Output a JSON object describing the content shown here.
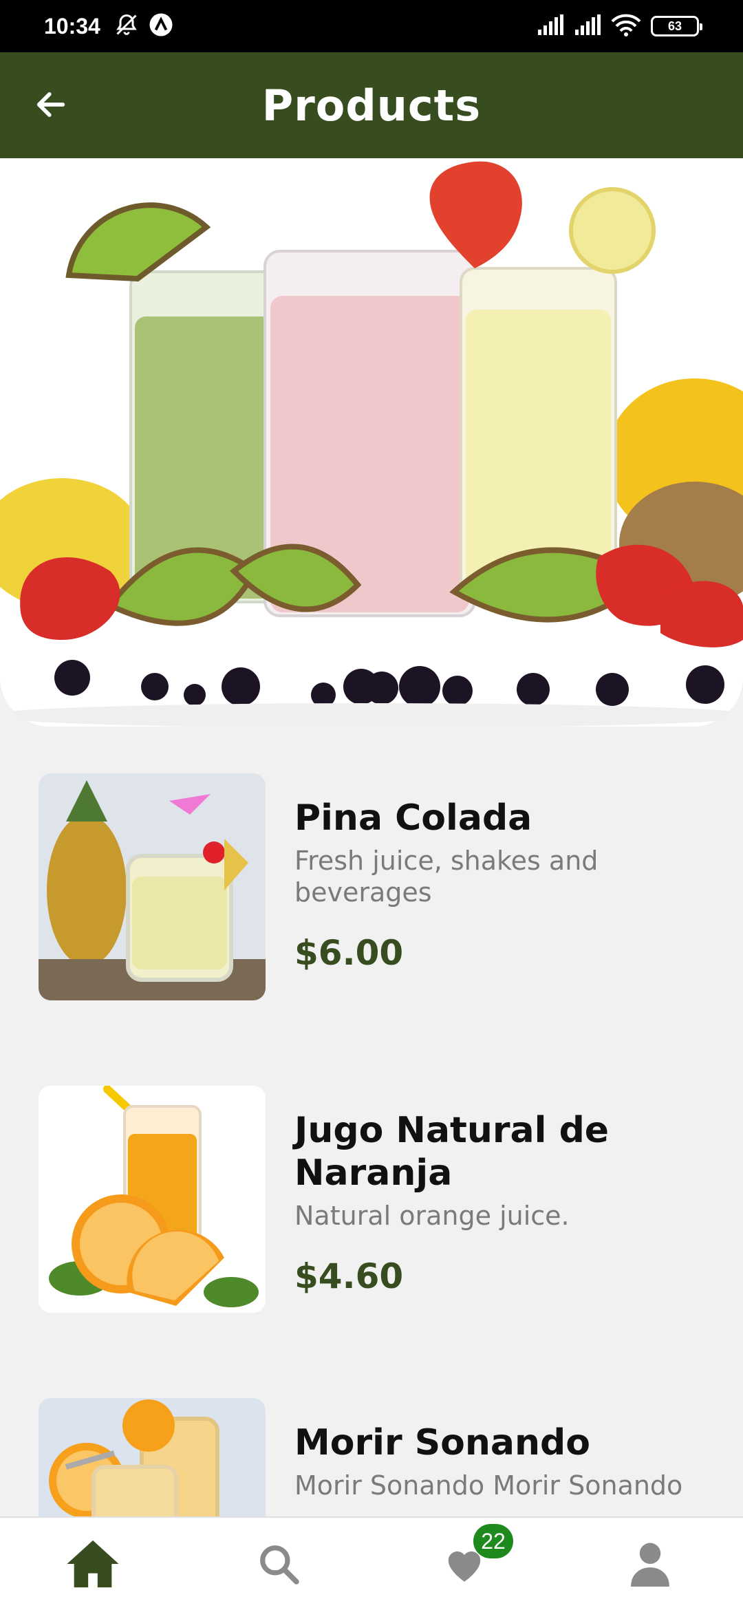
{
  "status_bar": {
    "time": "10:34",
    "battery": "63"
  },
  "app_bar": {
    "title": "Products"
  },
  "products": [
    {
      "name": "Pina Colada",
      "description": "Fresh juice, shakes and beverages",
      "price": "$6.00"
    },
    {
      "name": "Jugo Natural de Naranja",
      "description": "Natural orange juice.",
      "price": "$4.60"
    },
    {
      "name": "Morir Sonando",
      "description": "Morir Sonando Morir Sonando",
      "price": ""
    }
  ],
  "bottom_nav": {
    "items": [
      {
        "icon": "home-icon",
        "active": true
      },
      {
        "icon": "search-icon",
        "active": false
      },
      {
        "icon": "heart-icon",
        "active": false,
        "badge": "22"
      },
      {
        "icon": "profile-icon",
        "active": false
      }
    ]
  },
  "colors": {
    "primary": "#374d1f",
    "badge": "#1e8a1e",
    "background": "#f1f1f1"
  }
}
